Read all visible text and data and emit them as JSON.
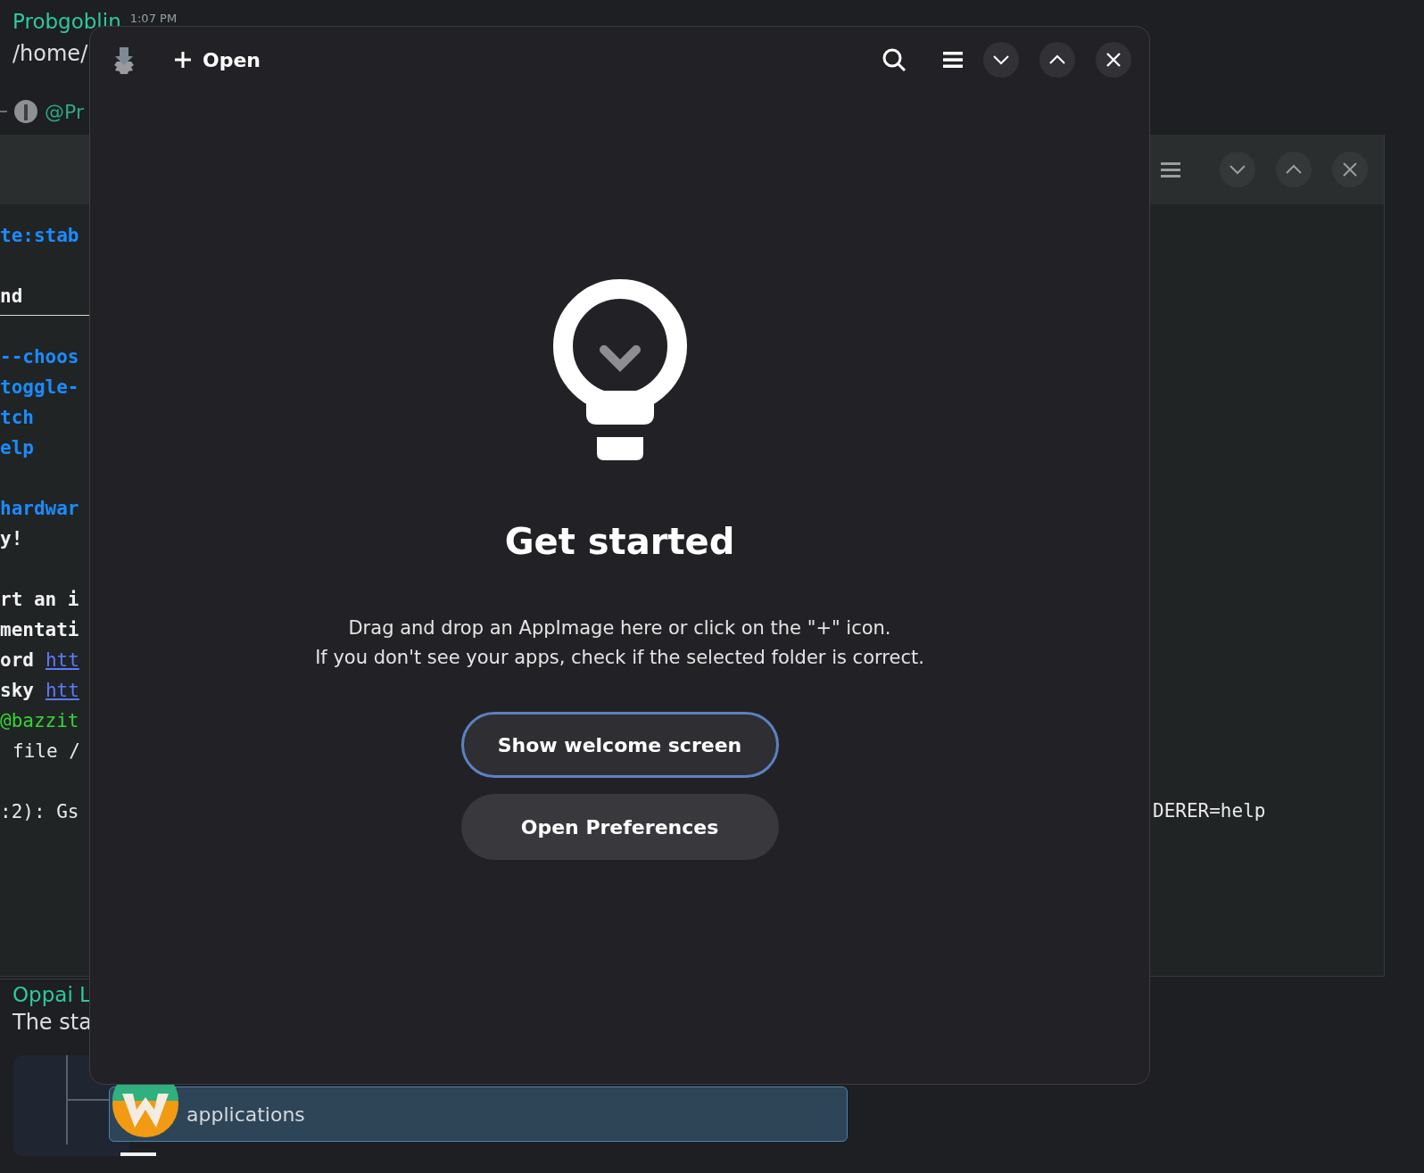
{
  "chat_top": {
    "author": "Probgoblin",
    "time": "1:07 PM",
    "text": "/home/",
    "reply_mention": "@Pr"
  },
  "terminal": {
    "blocks": [
      [
        {
          "kind": "flag",
          "text": "te:stab"
        }
      ],
      [
        {
          "kind": "bold",
          "text": "nd"
        },
        {
          "kind": "rule"
        },
        {
          "kind": "flag",
          "text": "--choos"
        },
        {
          "kind": "flag",
          "text": "toggle-"
        },
        {
          "kind": "flag",
          "text": "tch"
        },
        {
          "kind": "flag",
          "text": "elp"
        }
      ],
      [
        {
          "kind": "flag",
          "text": "hardwar"
        },
        {
          "kind": "bold",
          "text": "y!"
        }
      ],
      [
        {
          "kind": "bold",
          "text": "rt an i"
        },
        {
          "kind": "bold",
          "text": "mentati"
        },
        {
          "kind": "bold",
          "text": "ord",
          "link": "htt"
        },
        {
          "kind": "bold",
          "text": "sky",
          "link": "htt"
        },
        {
          "kind": "success",
          "text": "@bazzit"
        },
        {
          "kind": "indented",
          "text": "file /"
        }
      ],
      [
        {
          "kind": "plain",
          "text": ":2): Gs",
          "right_text": "DERER=help"
        }
      ]
    ]
  },
  "chat_bottom": {
    "author": "Oppai L",
    "text": "The sta",
    "attachment": {
      "name": "applications"
    }
  },
  "app_window": {
    "open_button": "Open",
    "title": "Get started",
    "description": [
      "Drag and drop an AppImage here or click on the \"+\" icon.",
      "If you don't see your apps, check if the selected folder is correct."
    ],
    "buttons": [
      {
        "label": "Show welcome screen",
        "focused": true
      },
      {
        "label": "Open Preferences",
        "focused": false
      }
    ]
  }
}
